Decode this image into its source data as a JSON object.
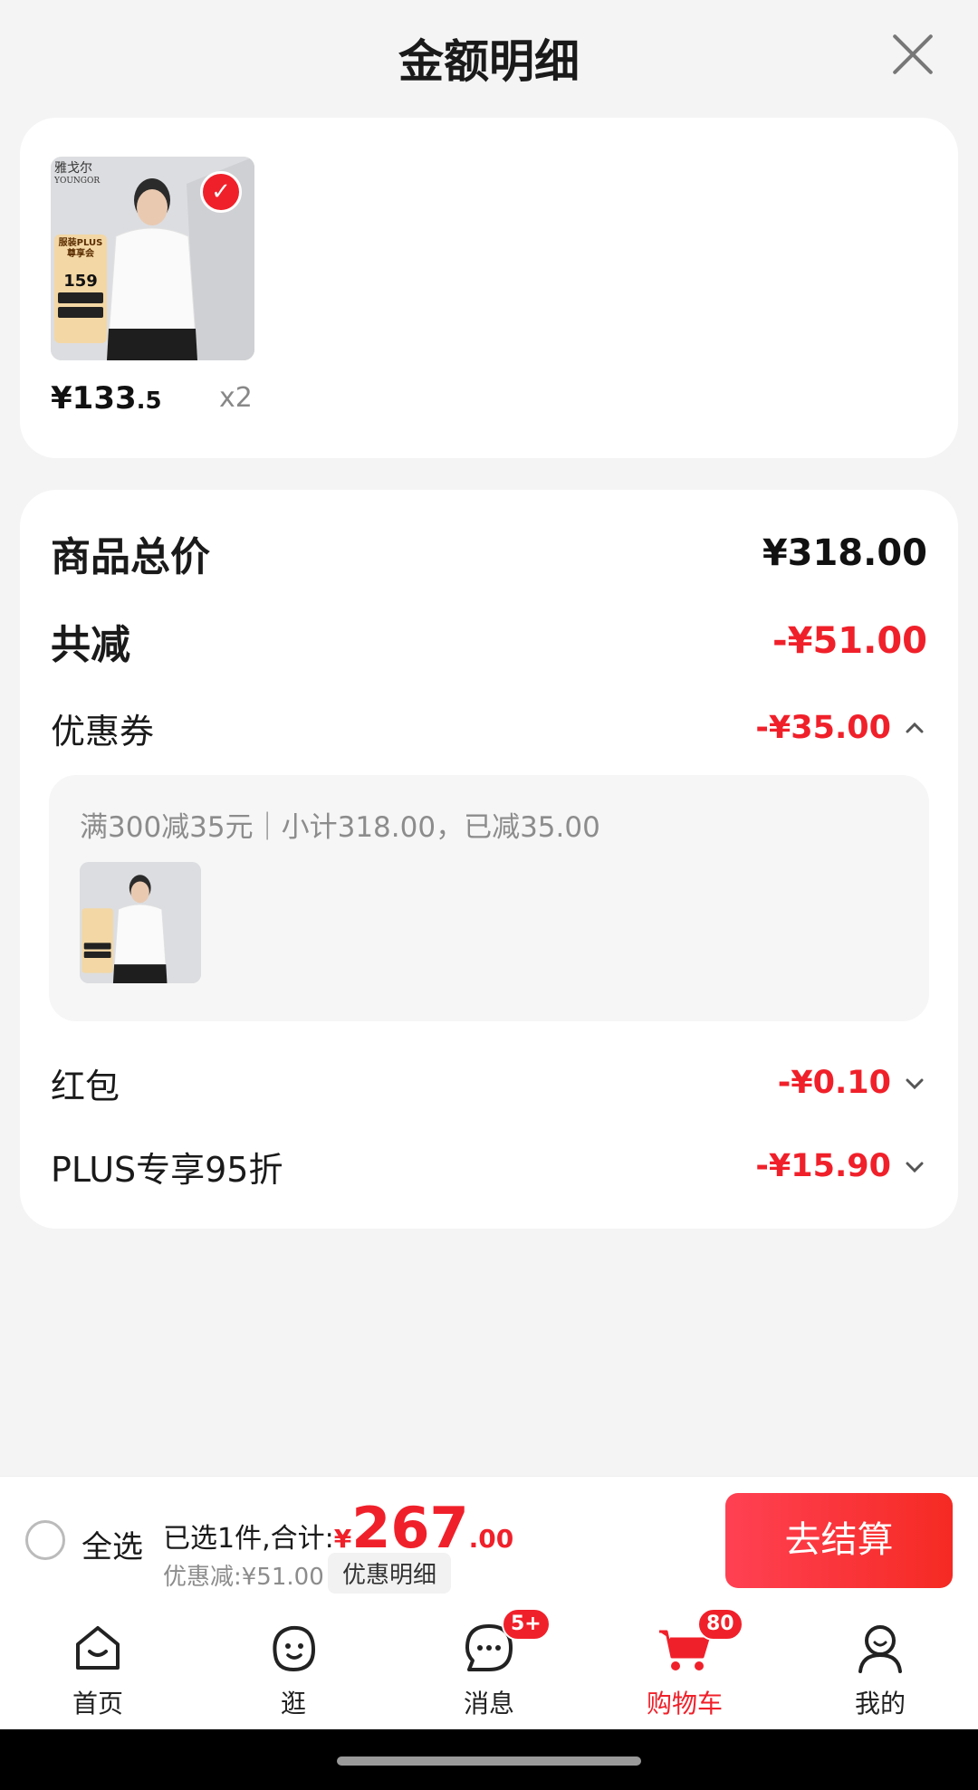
{
  "sheet": {
    "title": "金额明细"
  },
  "product": {
    "brand": "雅戈尔",
    "brand_en": "YOUNGOR",
    "promo_badge": "服装PLUS",
    "promo_badge_2": "尊享会",
    "promo_price": "159",
    "price_int": "¥133",
    "price_dec": ".5",
    "qty": "x2"
  },
  "details": {
    "total_label": "商品总价",
    "total_value": "¥318.00",
    "reduce_label": "共减",
    "reduce_value": "-¥51.00",
    "coupon_label": "优惠券",
    "coupon_value": "-¥35.00",
    "coupon_desc": "满300减35元｜小计318.00，已减35.00",
    "redpacket_label": "红包",
    "redpacket_value": "-¥0.10",
    "plus_label": "PLUS专享95折",
    "plus_value": "-¥15.90"
  },
  "bottom": {
    "select_all": "全选",
    "selected_text": "已选1件,合计:",
    "currency": "¥",
    "total_int": "267",
    "total_dec": ".00",
    "discount_text": "优惠减:¥51.00",
    "detail_chip": "优惠明细",
    "checkout": "去结算"
  },
  "tabs": [
    {
      "label": "首页",
      "icon": "home-icon"
    },
    {
      "label": "逛",
      "icon": "browse-icon"
    },
    {
      "label": "消息",
      "icon": "message-icon",
      "badge": "5+"
    },
    {
      "label": "购物车",
      "icon": "cart-icon",
      "badge": "80",
      "active": true
    },
    {
      "label": "我的",
      "icon": "profile-icon"
    }
  ],
  "colors": {
    "accent": "#f0202a",
    "background": "#f4f4f4"
  }
}
